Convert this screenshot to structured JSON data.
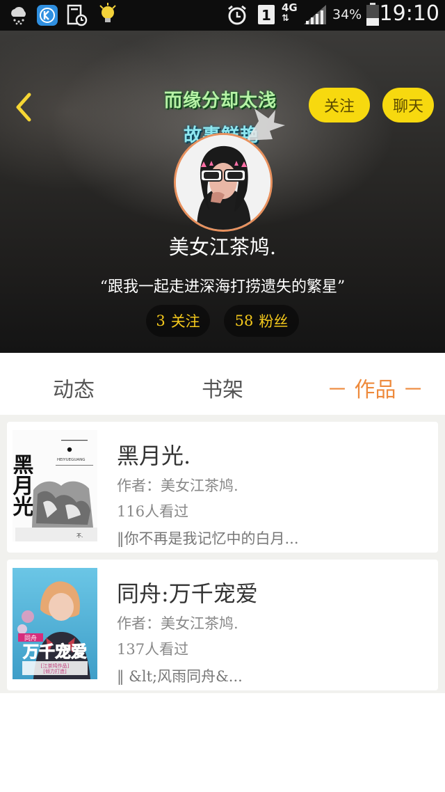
{
  "status_bar": {
    "signal_label": "1",
    "network": "4G",
    "battery": "34%",
    "time": "19:10",
    "icons": [
      "weather-rain-icon",
      "k-app-icon",
      "calendar-clock-icon",
      "lightbulb-icon",
      "alarm-icon",
      "sim-icon",
      "signal-icon",
      "battery-icon"
    ]
  },
  "header": {
    "art_text_line1": "而缘分却太浅",
    "art_text_line2": "故事鲜艳",
    "follow_button": "关注",
    "chat_button": "聊天",
    "username": "美女江茶鸠.",
    "bio": "“跟我一起走进深海打捞遗失的繁星”",
    "following_count": "3",
    "following_label": "关注",
    "fans_count": "58",
    "fans_label": "粉丝"
  },
  "tabs": {
    "dynamics": "动态",
    "shelf": "书架",
    "works": "－ 作品 －",
    "active": "works"
  },
  "works": [
    {
      "title": "黑月光.",
      "author": "作者：美女江茶鸠.",
      "views": "116人看过",
      "desc": "‖你不再是我记忆中的白月...",
      "cover_text": "黑月光",
      "cover_sub": "HEIYUEGUANG"
    },
    {
      "title": "同舟:万千宠爱",
      "author": "作者：美女江茶鸠.",
      "views": "137人看过",
      "desc": "‖ &lt;风雨同舟&...",
      "cover_text": "万千宠爱",
      "cover_tag": "同舟"
    }
  ],
  "colors": {
    "accent_yellow": "#f7d90f",
    "tab_active": "#ee8a3c",
    "stat_text": "#f3c81c",
    "avatar_border": "#e8915e"
  }
}
